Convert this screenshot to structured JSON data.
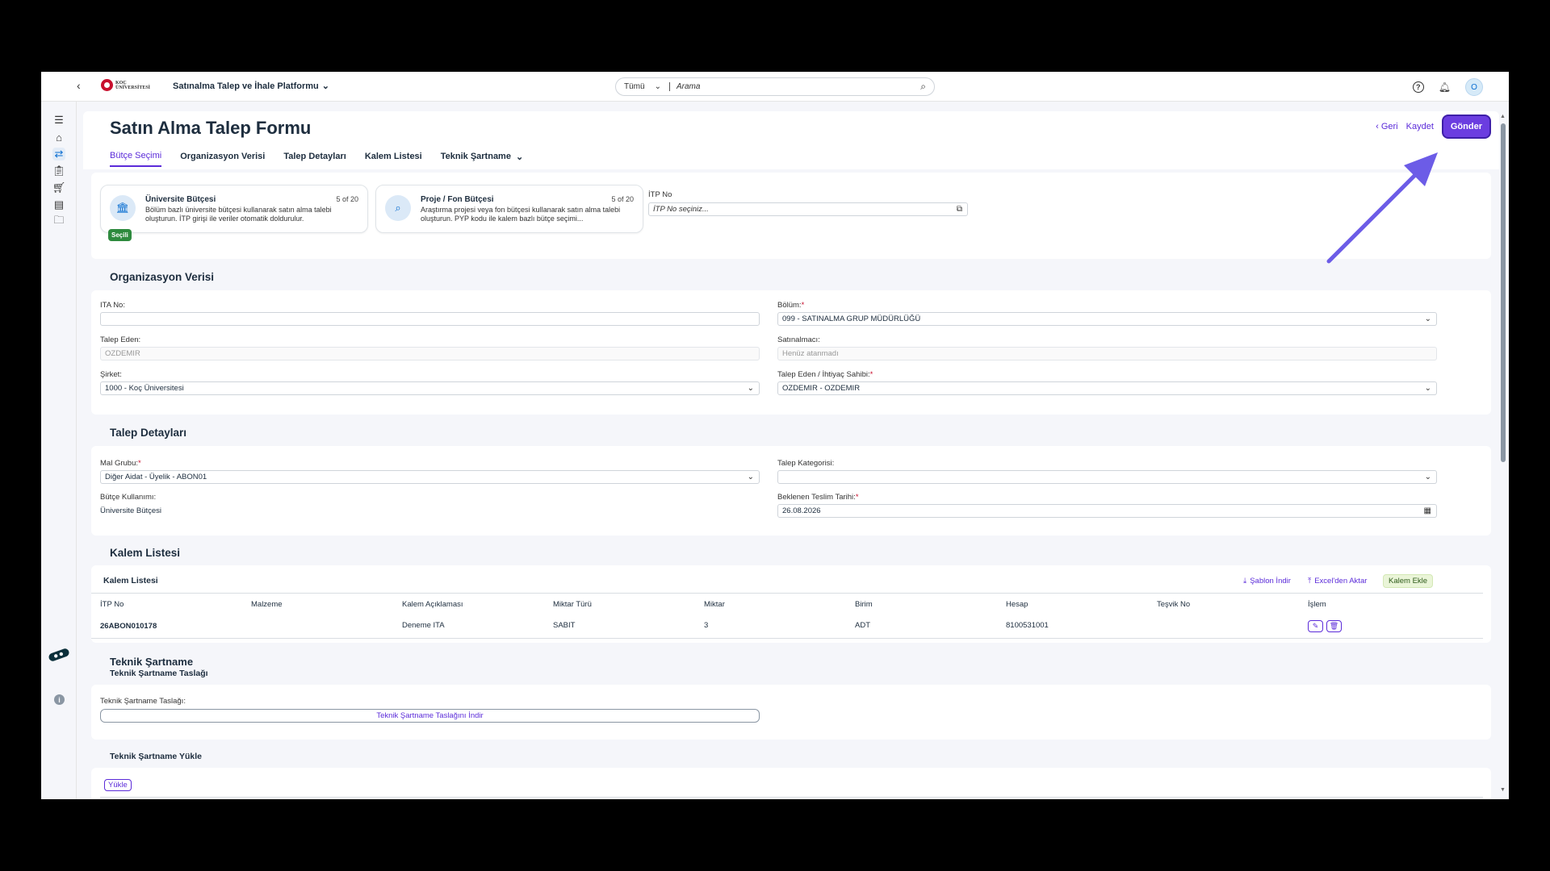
{
  "shell": {
    "platform_name": "Satınalma Talep ve İhale Platformu",
    "search_scope": "Tümü",
    "search_placeholder": "Arama",
    "avatar_initial": "O",
    "logo_line1": "KOÇ",
    "logo_line2": "ÜNİVERSİTESİ"
  },
  "page": {
    "title": "Satın Alma Talep Formu",
    "tabs": [
      "Bütçe Seçimi",
      "Organizasyon Verisi",
      "Talep Detayları",
      "Kalem Listesi",
      "Teknik Şartname"
    ],
    "actions": {
      "back": "Geri",
      "save": "Kaydet",
      "send": "Gönder"
    }
  },
  "budget": {
    "university": {
      "title": "Üniversite Bütçesi",
      "count": "5 of 20",
      "desc": "Bölüm bazlı üniversite bütçesi kullanarak satın alma talebi oluşturun. İTP girişi ile veriler otomatik doldurulur."
    },
    "project": {
      "title": "Proje / Fon Bütçesi",
      "count": "5 of 20",
      "desc": "Araştırma projesi veya fon bütçesi kullanarak satın alma talebi oluşturun. PYP kodu ile kalem bazlı bütçe seçimi..."
    },
    "selected_badge": "Seçili",
    "itp_label": "İTP No",
    "itp_placeholder": "İTP No seçiniz..."
  },
  "org": {
    "section": "Organizasyon Verisi",
    "ita_label": "ITA No:",
    "ita_value": "",
    "department_label": "Bölüm:",
    "department_value": "099 - SATINALMA GRUP MÜDÜRLÜĞÜ",
    "requester_label": "Talep Eden:",
    "requester_value": "OZDEMIR",
    "buyer_label": "Satınalmacı:",
    "buyer_value": "Henüz atanmadı",
    "company_label": "Şirket:",
    "company_value": "1000 - Koç Üniversitesi",
    "owner_label": "Talep Eden / İhtiyaç Sahibi:",
    "owner_value": "OZDEMIR - OZDEMIR",
    "required_mark": "*"
  },
  "details": {
    "section": "Talep Detayları",
    "material_group_label": "Mal Grubu:",
    "material_group_value": "Diğer Aidat - Üyelik - ABON01",
    "category_label": "Talep Kategorisi:",
    "category_value": "",
    "budget_usage_label": "Bütçe Kullanımı:",
    "budget_usage_value": "Üniversite Bütçesi",
    "delivery_label": "Beklenen Teslim Tarihi:",
    "delivery_value": "26.08.2026"
  },
  "items": {
    "section": "Kalem Listesi",
    "panel_title": "Kalem Listesi",
    "download_template": "Şablon İndir",
    "import_excel": "Excel'den Aktar",
    "add_item": "Kalem Ekle",
    "columns": [
      "İTP No",
      "Malzeme",
      "Kalem Açıklaması",
      "Miktar Türü",
      "Miktar",
      "Birim",
      "Hesap",
      "Teşvik No",
      "İşlem"
    ],
    "rows": [
      [
        "26ABON010178",
        "",
        "Deneme ITA",
        "SABIT",
        "3",
        "ADT",
        "8100531001",
        ""
      ]
    ]
  },
  "spec": {
    "section": "Teknik Şartname",
    "draft_title": "Teknik Şartname Taslağı",
    "draft_label": "Teknik Şartname Taslağı:",
    "draft_download": "Teknik Şartname Taslağını İndir",
    "upload_title": "Teknik Şartname Yükle",
    "upload_button": "Yükle"
  },
  "colors": {
    "accent": "#5b2bd9",
    "primary_button": "#6b3de0",
    "success": "#2e8a3e",
    "arrow": "#6c5ce7"
  }
}
